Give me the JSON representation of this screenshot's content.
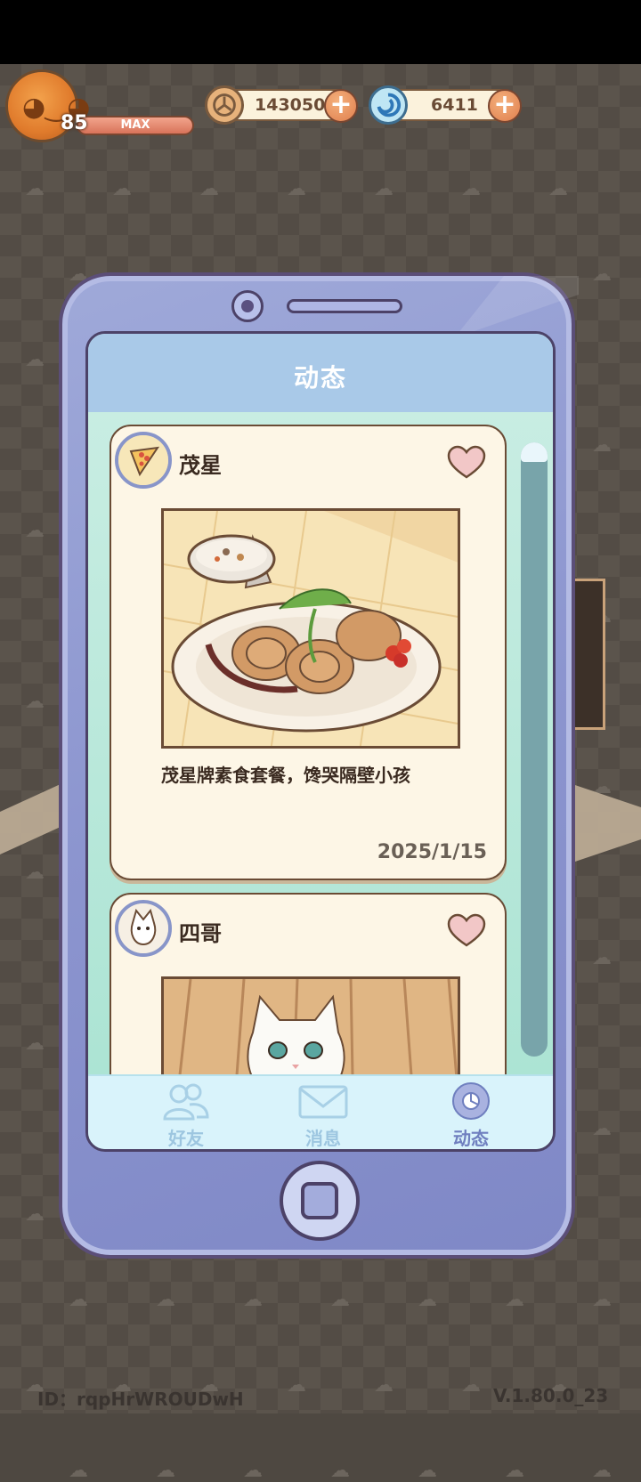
{
  "hud": {
    "level": "85",
    "level_status": "MAX",
    "coins": "143050",
    "gems": "6411"
  },
  "app": {
    "title": "动态",
    "posts": [
      {
        "author": "茂星",
        "caption": "茂星牌素食套餐，馋哭隔壁小孩",
        "date": "2025/1/15"
      },
      {
        "author": "四哥",
        "caption": "",
        "date": ""
      }
    ],
    "tabs": [
      {
        "label": "好友",
        "icon": "friends-icon"
      },
      {
        "label": "消息",
        "icon": "mail-icon"
      },
      {
        "label": "动态",
        "icon": "feed-icon"
      }
    ],
    "active_tab": "动态"
  },
  "footer": {
    "player_id": "ID：rqpHrWROUDwH",
    "version": "V.1.80.0_23"
  },
  "colors": {
    "accent": "#8c95cf",
    "card": "#fdf6e6",
    "heart": "#f2c7c7"
  }
}
